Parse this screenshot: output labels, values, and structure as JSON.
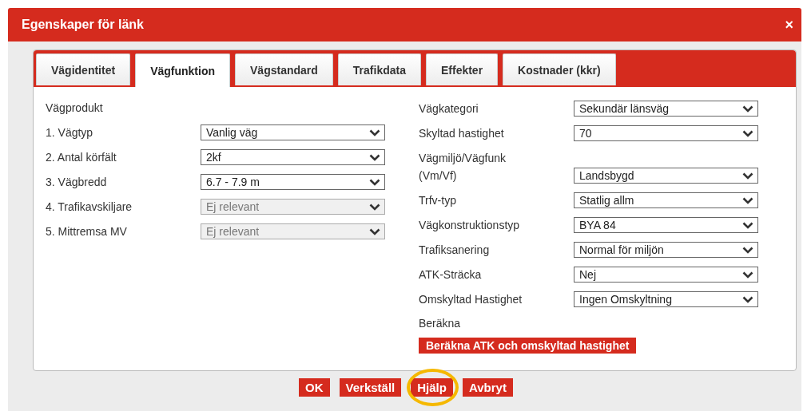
{
  "window": {
    "title": "Egenskaper för länk",
    "close": "×"
  },
  "tabs": [
    {
      "label": "Vägidentitet",
      "selected": false
    },
    {
      "label": "Vägfunktion",
      "selected": true
    },
    {
      "label": "Vägstandard",
      "selected": false
    },
    {
      "label": "Trafikdata",
      "selected": false
    },
    {
      "label": "Effekter",
      "selected": false
    },
    {
      "label": "Kostnader (kkr)",
      "selected": false
    }
  ],
  "left": {
    "heading": "Vägprodukt",
    "fields": [
      {
        "label": "1. Vägtyp",
        "value": "Vanlig väg",
        "disabled": false
      },
      {
        "label": "2. Antal körfält",
        "value": "2kf",
        "disabled": false
      },
      {
        "label": "3. Vägbredd",
        "value": "6.7 - 7.9 m",
        "disabled": false
      },
      {
        "label": "4. Trafikavskiljare",
        "value": "Ej relevant",
        "disabled": true
      },
      {
        "label": "5. Mittremsa MV",
        "value": "Ej relevant",
        "disabled": true
      }
    ]
  },
  "right": {
    "fields": [
      {
        "label": "Vägkategori",
        "value": "Sekundär länsväg",
        "disabled": false
      },
      {
        "label": "Skyltad hastighet",
        "value": "70",
        "disabled": false
      },
      {
        "label": "Vägmiljö/Vägfunk\n(Vm/Vf)",
        "value": "Landsbygd",
        "disabled": false
      },
      {
        "label": "Trfv-typ",
        "value": "Statlig allm",
        "disabled": false
      },
      {
        "label": "Vägkonstruktionstyp",
        "value": "BYA 84",
        "disabled": false
      },
      {
        "label": "Trafiksanering",
        "value": "Normal för miljön",
        "disabled": false
      },
      {
        "label": "ATK-Sträcka",
        "value": "Nej",
        "disabled": false
      },
      {
        "label": "Omskyltad Hastighet",
        "value": "Ingen Omskyltning",
        "disabled": false
      }
    ],
    "compute_heading": "Beräkna",
    "compute_button": "Beräkna ATK och omskyltad hastighet"
  },
  "footer_buttons": [
    {
      "label": "OK",
      "highlighted": false
    },
    {
      "label": "Verkställ",
      "highlighted": false
    },
    {
      "label": "Hjälp",
      "highlighted": true
    },
    {
      "label": "Avbryt",
      "highlighted": false
    }
  ]
}
